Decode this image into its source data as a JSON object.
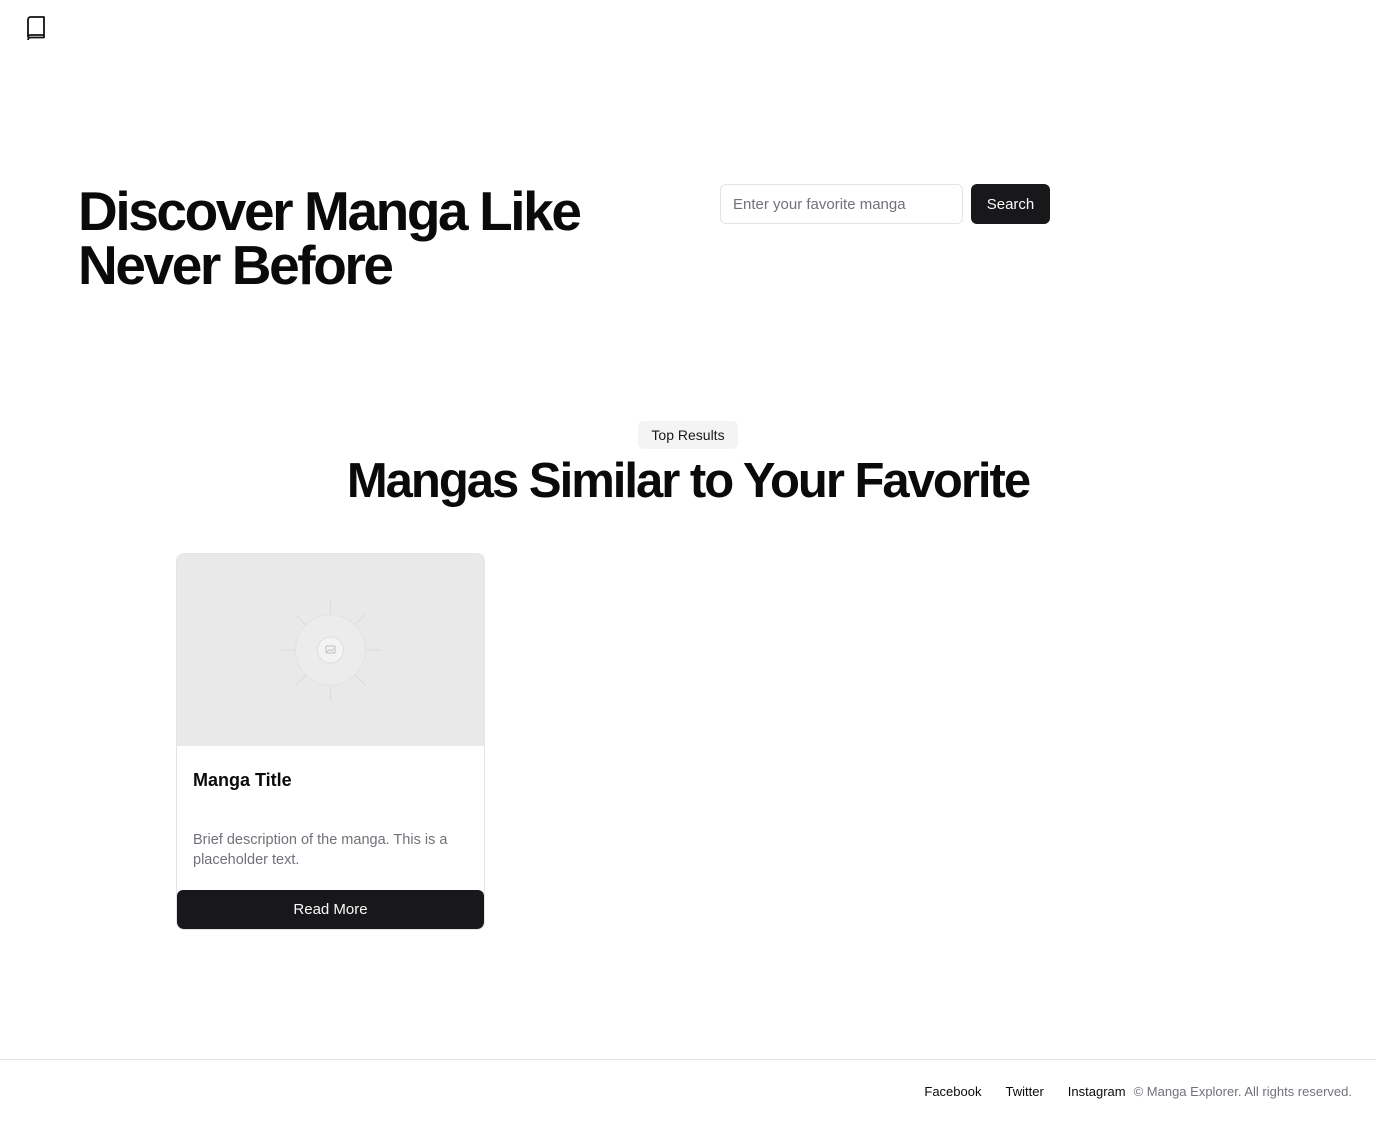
{
  "header": {
    "logo_icon": "book-icon"
  },
  "hero": {
    "title": "Discover Manga Like Never Before",
    "search": {
      "placeholder": "Enter your favorite manga",
      "value": "",
      "button_label": "Search"
    }
  },
  "results": {
    "badge": "Top Results",
    "title": "Mangas Similar to Your Favorite",
    "cards": [
      {
        "image_icon": "image-placeholder-icon",
        "title": "Manga Title",
        "description": "Brief description of the manga. This is a placeholder text.",
        "button_label": "Read More"
      }
    ]
  },
  "footer": {
    "links": [
      "Facebook",
      "Twitter",
      "Instagram"
    ],
    "copyright": "© Manga Explorer. All rights reserved."
  },
  "colors": {
    "primary": "#18181b",
    "muted_text": "#71717a",
    "border": "#e4e4e7",
    "badge_bg": "#f4f4f5",
    "placeholder_bg": "#e9e9e9"
  }
}
